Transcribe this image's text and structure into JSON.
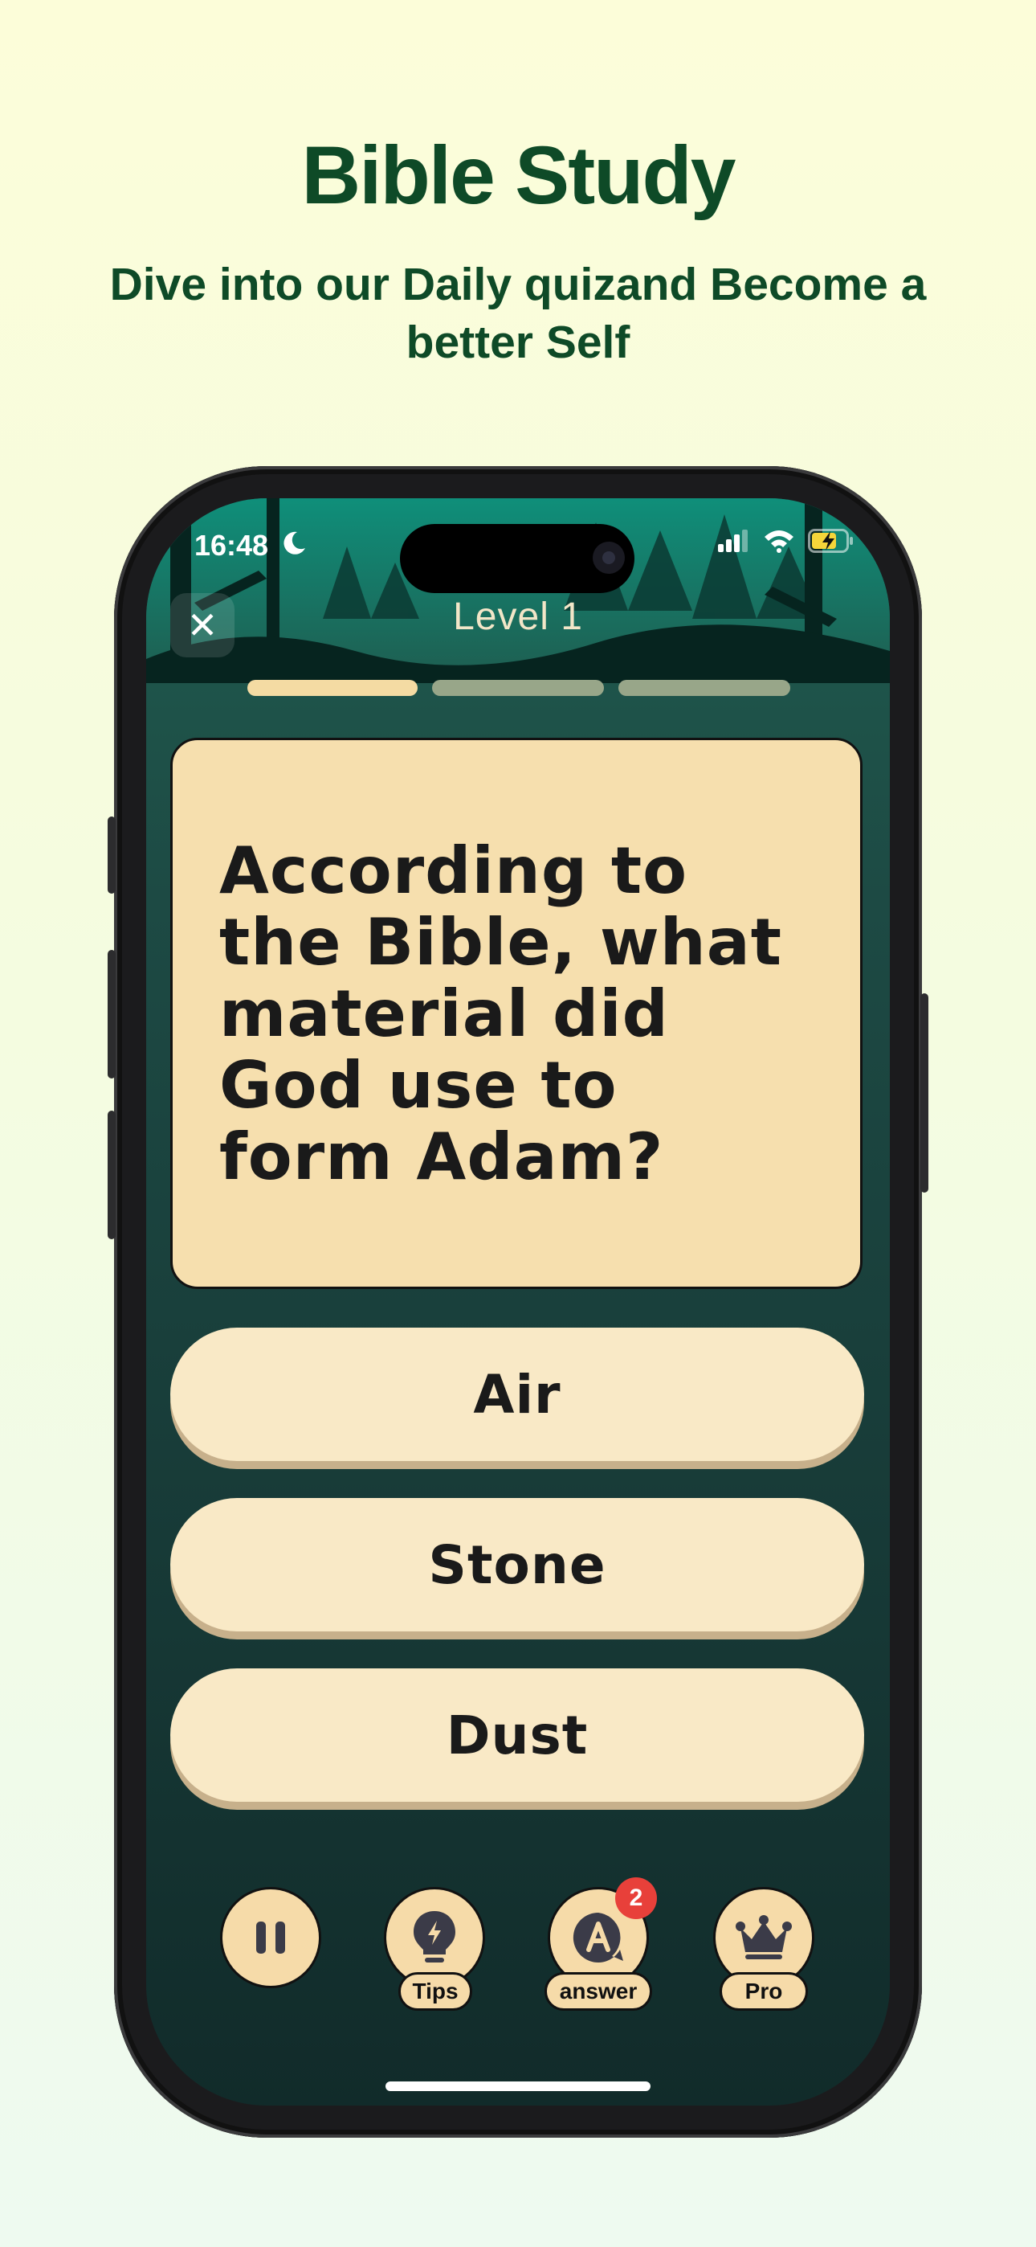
{
  "promo": {
    "title": "Bible Study",
    "subtitle": "Dive into our Daily quizand Become a better Self"
  },
  "status_bar": {
    "time": "16:48"
  },
  "header": {
    "level_label": "Level  1",
    "close_glyph": "✕"
  },
  "progress": {
    "segments_total": 3,
    "segments_completed": 1,
    "active_color": "#f4dba3",
    "inactive_color": "#98a689"
  },
  "question": {
    "text": "According to the Bible, what material did God use to form Adam?"
  },
  "answers": [
    {
      "label": "Air"
    },
    {
      "label": "Stone"
    },
    {
      "label": "Dust"
    }
  ],
  "toolbar": {
    "pause": {
      "icon": "pause-icon"
    },
    "tips": {
      "label": "Tips",
      "icon": "lightbulb-icon"
    },
    "answer": {
      "label": "answer",
      "icon": "letter-a-icon",
      "badge": "2"
    },
    "pro": {
      "label": "Pro",
      "icon": "crown-icon"
    }
  },
  "colors": {
    "brand_green": "#0e4a27",
    "card": "#f6dfae",
    "answer_button": "#f9e9c6",
    "badge": "#e8403a"
  }
}
